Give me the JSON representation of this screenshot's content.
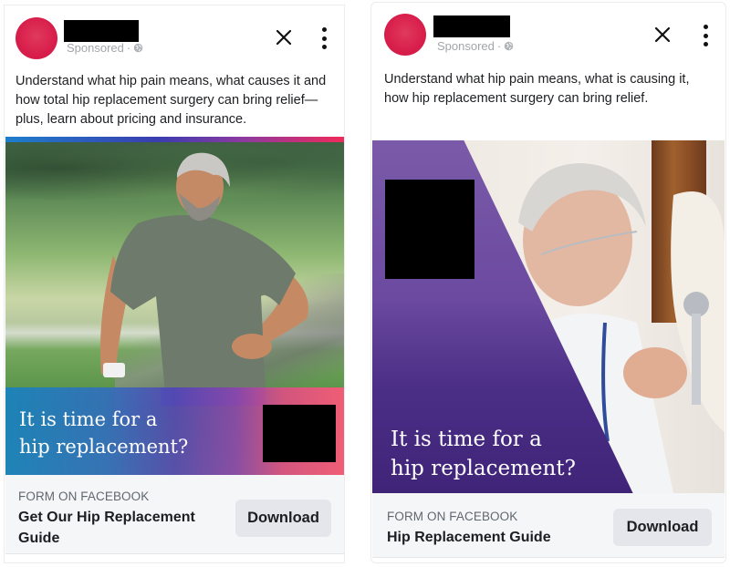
{
  "ads": [
    {
      "sponsored_label": "Sponsored",
      "sponsored_separator": "·",
      "body_text": "Understand what hip pain means, what causes it and how total hip replacement surgery can bring relief—plus, learn about pricing and insurance.",
      "banner_line1": "It is time for a",
      "banner_line2": "hip replacement?",
      "form_label": "FORM ON FACEBOOK",
      "form_title": "Get Our Hip Replacement Guide",
      "cta_label": "Download",
      "icons": {
        "close": "close-icon",
        "more": "more-options-icon",
        "audience": "globe-icon"
      },
      "colors": {
        "avatar": "#d81e4b",
        "gradient_start": "#1e7ecb",
        "gradient_end": "#f02a5a"
      }
    },
    {
      "sponsored_label": "Sponsored",
      "sponsored_separator": "·",
      "body_text": "Understand what hip pain means, what is causing it, how hip replacement surgery can bring relief.",
      "banner_line1": "It is time for a",
      "banner_line2": "hip replacement?",
      "form_label": "FORM ON FACEBOOK",
      "form_title": "Hip Replacement Guide",
      "cta_label": "Download",
      "icons": {
        "close": "close-icon",
        "more": "more-options-icon",
        "audience": "globe-icon"
      },
      "colors": {
        "avatar": "#d81e4b",
        "overlay": "#6b4aa0"
      }
    }
  ]
}
